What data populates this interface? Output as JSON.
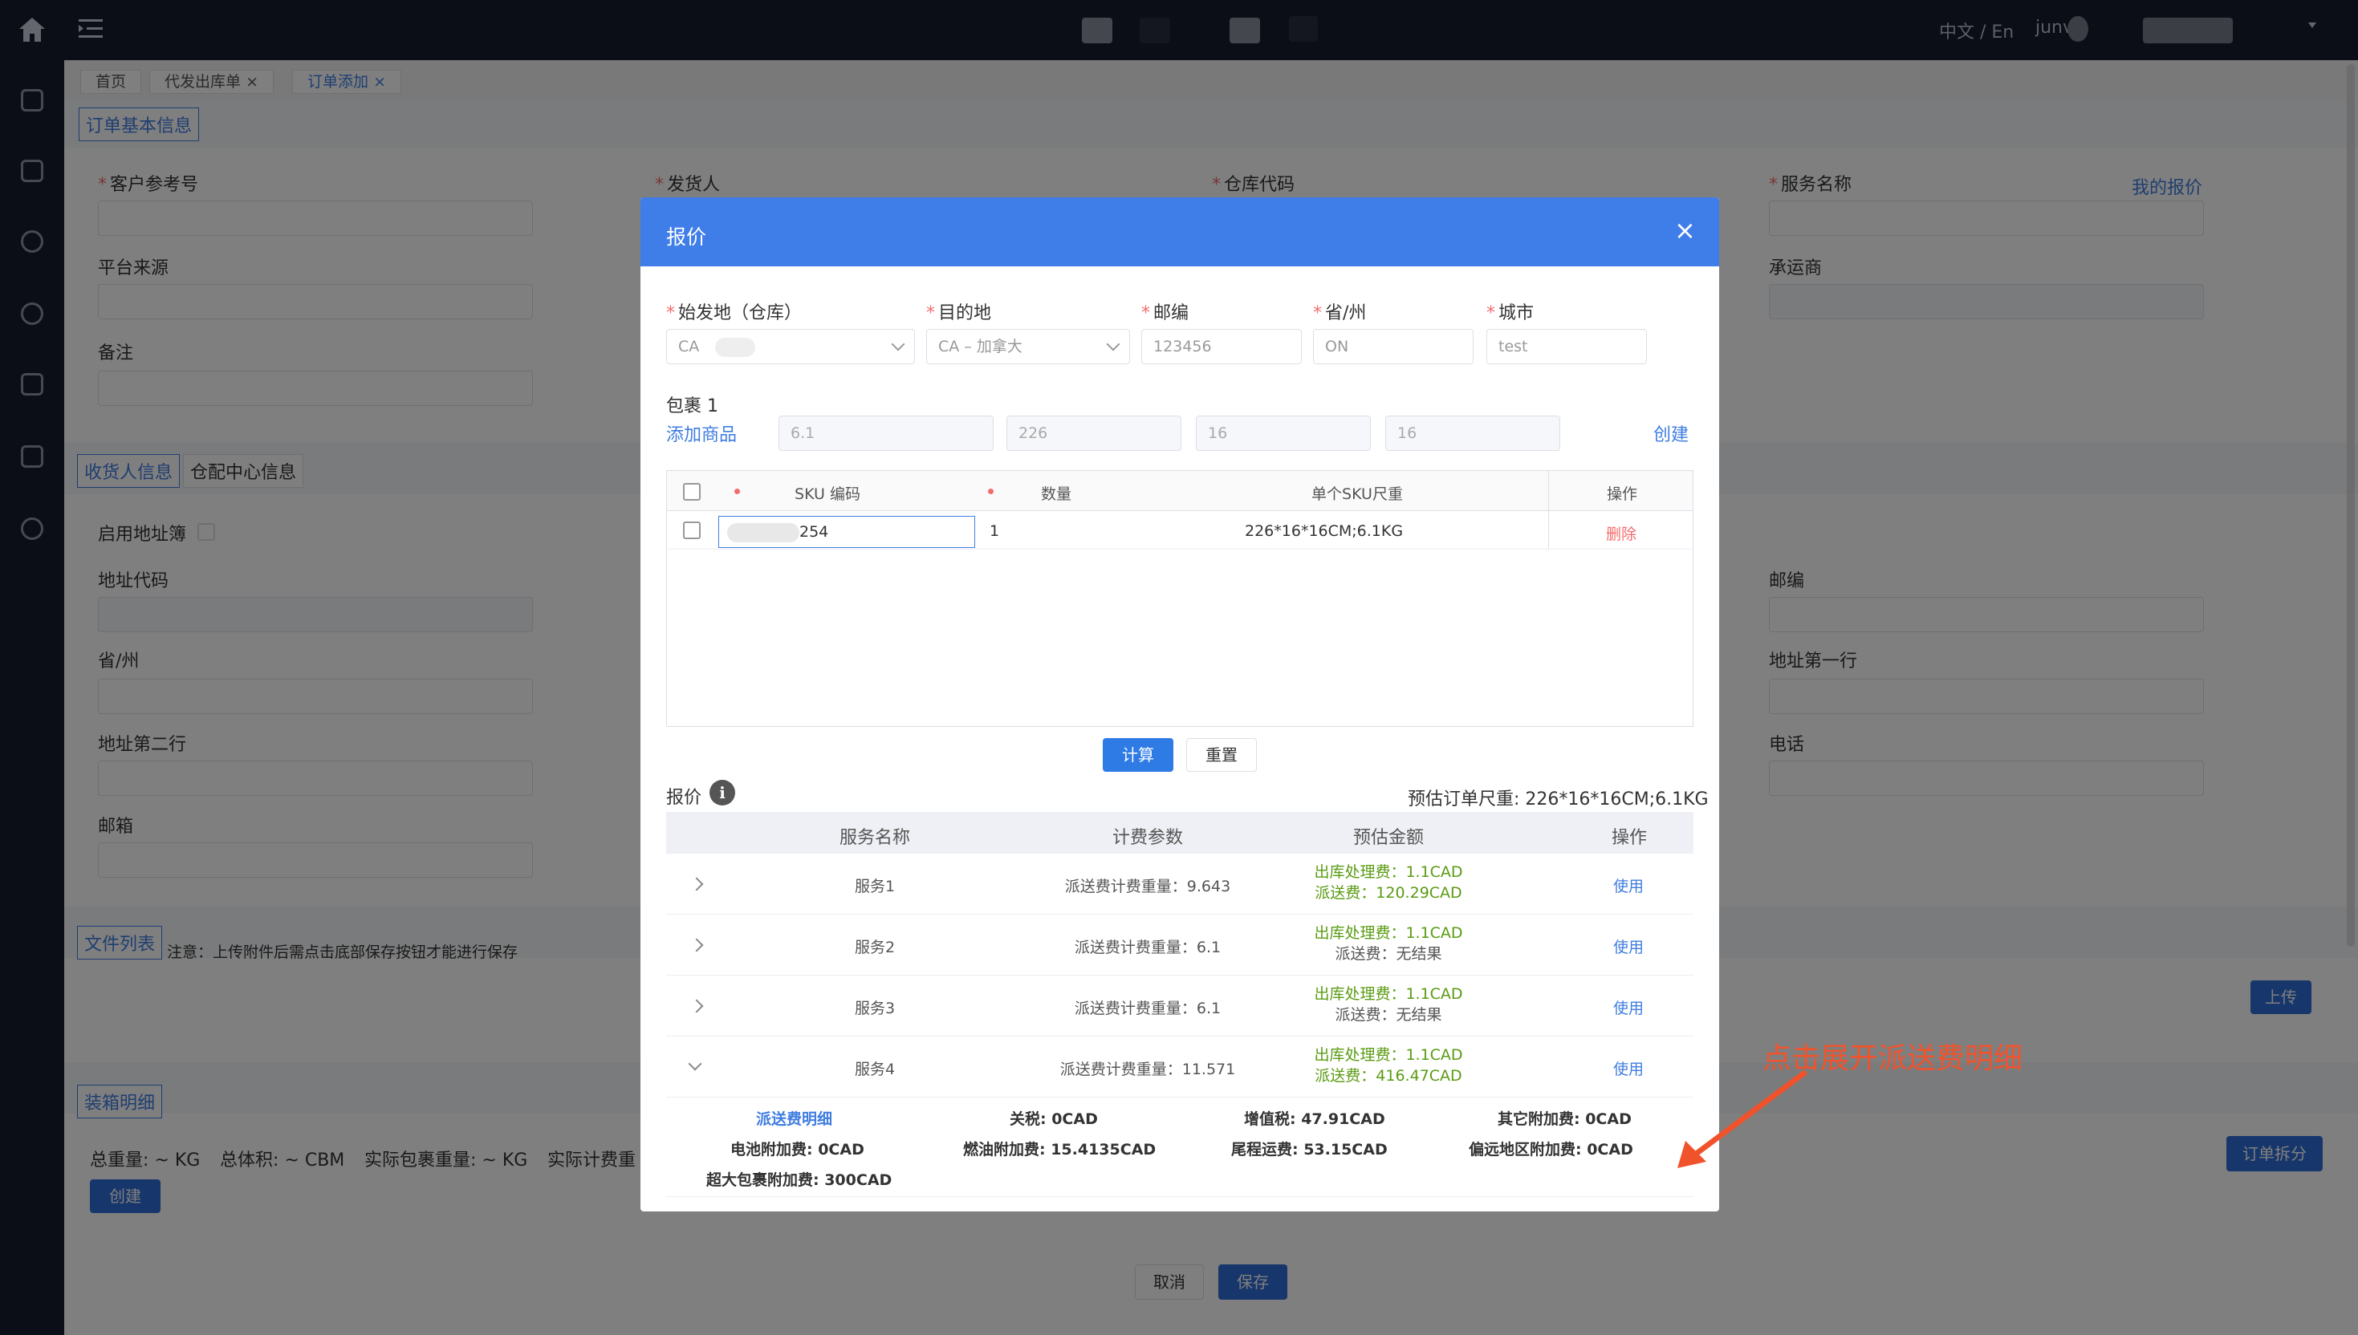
{
  "topbar": {
    "lang_toggle": "中文 / En",
    "username": "junv"
  },
  "tabs": [
    {
      "label": "首页"
    },
    {
      "label": "代发出库单",
      "close": "×"
    },
    {
      "label": "订单添加",
      "close": "×"
    }
  ],
  "form": {
    "basic_info_tag": "订单基本信息",
    "customer_ref": "客户参考号",
    "sender": "发货人",
    "warehouse_code": "仓库代码",
    "service_name": "服务名称",
    "my_quote": "我的报价",
    "platform_source": "平台来源",
    "carrier": "承运商",
    "remark": "备注",
    "receiver_tag": "收货人信息",
    "distribution_tag": "仓配中心信息",
    "use_address_book": "启用地址簿",
    "address_code": "地址代码",
    "postcode": "邮编",
    "province": "省/州",
    "address_line1": "地址第一行",
    "address_line2": "地址第二行",
    "phone": "电话",
    "email": "邮箱",
    "file_list_tag": "文件列表",
    "file_note": "注意：上传附件后需点击底部保存按钮才能进行保存",
    "upload_btn": "上传",
    "packing_tag": "装箱明细",
    "total_weight": "总重量: ~ KG",
    "total_volume": "总体积: ~ CBM",
    "actual_weight": "实际包裹重量: ~ KG",
    "billing_weight": "实际计费重",
    "create_btn": "创建",
    "split_btn": "订单拆分",
    "cancel_btn": "取消",
    "save_btn": "保存"
  },
  "modal": {
    "title": "报价",
    "close": "×",
    "origin_label": "始发地（仓库）",
    "origin_value": "CA",
    "dest_label": "目的地",
    "dest_value": "CA – 加拿大",
    "postcode_label": "邮编",
    "postcode_value": "123456",
    "province_label": "省/州",
    "province_value": "ON",
    "city_label": "城市",
    "city_value": "test",
    "package_label": "包裹 1",
    "add_goods": "添加商品",
    "pkg_weight": "6.1",
    "pkg_length": "226",
    "pkg_width": "16",
    "pkg_height": "16",
    "create": "创建",
    "table": {
      "headers": [
        "SKU 编码",
        "数量",
        "单个SKU尺重",
        "操作"
      ],
      "row": {
        "sku": "254",
        "qty": "1",
        "size": "226*16*16CM;6.1KG",
        "action": "删除"
      }
    },
    "calc_btn": "计算",
    "reset_btn": "重置",
    "quote_label": "报价",
    "info_icon": "i",
    "estimate": "预估订单尺重: 226*16*16CM;6.1KG",
    "quote_headers": [
      "服务名称",
      "计费参数",
      "预估金额",
      "操作"
    ],
    "quotes": [
      {
        "name": "服务1",
        "param": "派送费计费重量：9.643",
        "fee1": "出库处理费：1.1CAD",
        "fee2": "派送费：120.29CAD",
        "action": "使用"
      },
      {
        "name": "服务2",
        "param": "派送费计费重量：6.1",
        "fee1": "出库处理费：1.1CAD",
        "fee2": "派送费：无结果",
        "action": "使用"
      },
      {
        "name": "服务3",
        "param": "派送费计费重量：6.1",
        "fee1": "出库处理费：1.1CAD",
        "fee2": "派送费：无结果",
        "action": "使用"
      },
      {
        "name": "服务4",
        "param": "派送费计费重量：11.571",
        "fee1": "出库处理费：1.1CAD",
        "fee2": "派送费：416.47CAD",
        "action": "使用"
      }
    ],
    "detail": {
      "title": "派送费明细",
      "tariff": "关税: 0CAD",
      "vat": "增值税: 47.91CAD",
      "other": "其它附加费: 0CAD",
      "battery": "电池附加费: 0CAD",
      "fuel": "燃油附加费: 15.4135CAD",
      "lastmile": "尾程运费: 53.15CAD",
      "remote": "偏远地区附加费: 0CAD",
      "oversize": "超大包裹附加费: 300CAD"
    }
  },
  "annotation": "点击展开派送费明细",
  "colors": {
    "accent": "#3f7de9",
    "fee_green": "#5a9b12",
    "annotation": "#f0532c"
  }
}
